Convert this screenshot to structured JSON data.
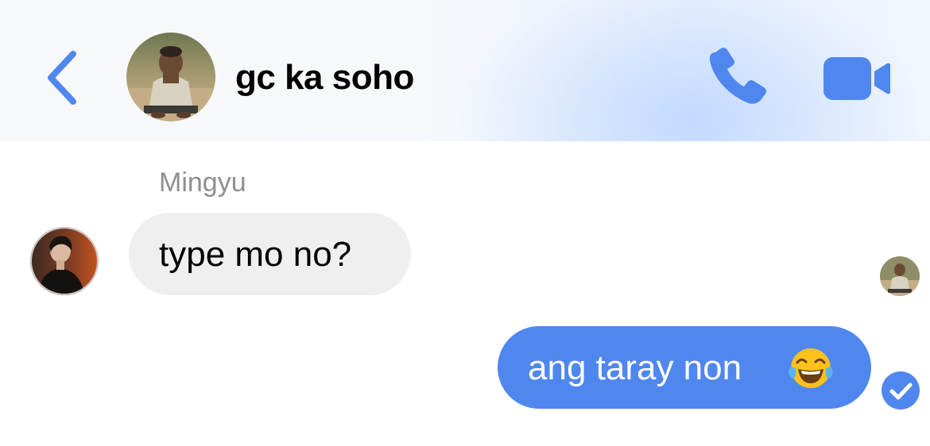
{
  "header": {
    "back_icon": "chevron-left-icon",
    "title": "gc ka soho",
    "call_icon": "phone-icon",
    "video_icon": "video-camera-icon",
    "accent_color": "#4f87ee"
  },
  "messages": [
    {
      "direction": "incoming",
      "sender": "Mingyu",
      "text": "type mo no?",
      "bubble_color": "#efeff0"
    },
    {
      "direction": "outgoing",
      "text": "ang taray non",
      "emoji": "face-with-tears-of-joy-icon",
      "bubble_color": "#4f87ee",
      "status": "sent-checkmark-icon",
      "seen_by": "group-avatar"
    }
  ]
}
